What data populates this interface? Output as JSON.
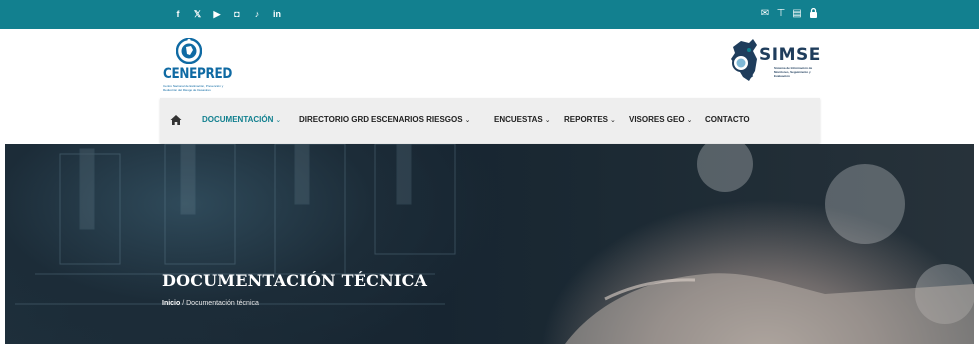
{
  "topbar": {
    "social": [
      {
        "name": "facebook-icon",
        "glyph": "f"
      },
      {
        "name": "x-icon",
        "glyph": "𝕏"
      },
      {
        "name": "youtube-icon",
        "glyph": "▶"
      },
      {
        "name": "instagram-icon",
        "glyph": "◘"
      },
      {
        "name": "tiktok-icon",
        "glyph": "♪"
      },
      {
        "name": "linkedin-icon",
        "glyph": "in"
      }
    ],
    "utility": [
      {
        "name": "mail-icon",
        "glyph": "✉"
      },
      {
        "name": "sitemap-icon",
        "glyph": "⊤"
      },
      {
        "name": "calendar-icon",
        "glyph": "▤"
      },
      {
        "name": "lock-icon",
        "glyph": "🔒"
      }
    ],
    "colors": {
      "bar": "#12808f"
    }
  },
  "header": {
    "left_logo": {
      "brand": "CENEPRED",
      "subtitle": "Centro Nacional de Estimación, Prevención y Reducción del Riesgo de Desastres"
    },
    "right_logo": {
      "brand": "SIMSE",
      "subtitle": "Sistema de Información de Monitoreo, Seguimiento y Evaluación"
    }
  },
  "nav": {
    "items": [
      {
        "label": "DOCUMENTACIÓN",
        "dropdown": true,
        "active": true
      },
      {
        "label": "DIRECTORIO GRD",
        "dropdown": false,
        "active": false
      },
      {
        "label": "ESCENARIOS RIESGOS",
        "dropdown": true,
        "active": false
      },
      {
        "label": "ENCUESTAS",
        "dropdown": true,
        "active": false
      },
      {
        "label": "REPORTES",
        "dropdown": true,
        "active": false
      },
      {
        "label": "VISORES GEO",
        "dropdown": true,
        "active": false
      },
      {
        "label": "CONTACTO",
        "dropdown": false,
        "active": false
      }
    ],
    "colors": {
      "active": "#12808f",
      "text": "#222222"
    }
  },
  "hero": {
    "title": "DOCUMENTACIÓN TÉCNICA",
    "breadcrumb": {
      "home": "Inicio",
      "separator": " / ",
      "current": "Documentación técnica"
    }
  }
}
